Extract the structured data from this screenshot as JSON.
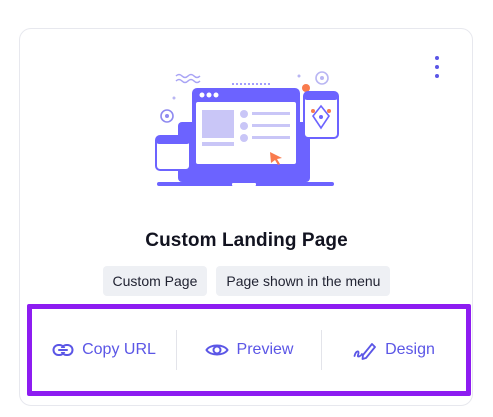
{
  "card": {
    "title": "Custom Landing Page",
    "tags": [
      "Custom Page",
      "Page shown in the menu"
    ],
    "menu_icon": "more-vertical-icon",
    "illustration": "landing-page-illustration"
  },
  "actions": [
    {
      "label": "Copy URL",
      "icon": "link-icon"
    },
    {
      "label": "Preview",
      "icon": "eye-icon"
    },
    {
      "label": "Design",
      "icon": "pen-icon"
    }
  ],
  "colors": {
    "accent": "#5b56e6",
    "highlight_border": "#8d1cf1",
    "tag_bg": "#eef0f4",
    "illustration_purple": "#6c63ff",
    "illustration_orange": "#f97b4d"
  }
}
